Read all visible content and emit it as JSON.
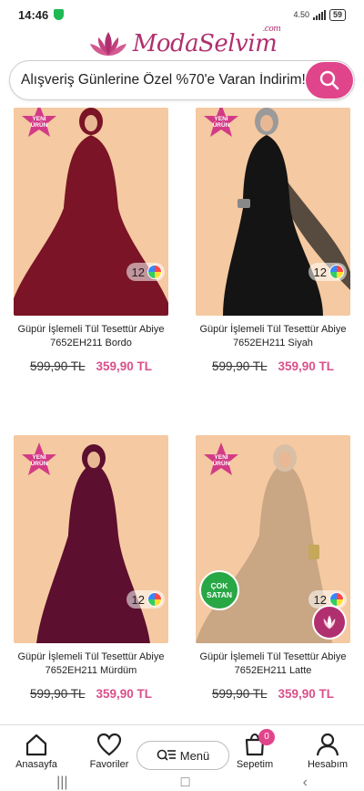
{
  "status_bar": {
    "time": "14:46",
    "network": "4.50",
    "battery": "59"
  },
  "header": {
    "logo_text": "ModaSelvim",
    "logo_suffix": ".com"
  },
  "search": {
    "text": "Alışveriş Günlerine Özel %70'e Varan İndirim!"
  },
  "products": [
    {
      "title_line1": "Güpür İşlemeli Tül Tesettür Abiye",
      "title_line2": "7652EH211 Bordo",
      "old_price": "599,90 TL",
      "new_price": "359,90 TL",
      "color_count": "12",
      "new_badge": [
        "YENİ",
        "ÜRÜN"
      ],
      "dress_color": "#7a1426",
      "hijab_color": "#7a1426"
    },
    {
      "title_line1": "Güpür İşlemeli Tül Tesettür Abiye",
      "title_line2": "7652EH211 Siyah",
      "old_price": "599,90 TL",
      "new_price": "359,90 TL",
      "color_count": "12",
      "new_badge": [
        "YENİ",
        "ÜRÜN"
      ],
      "dress_color": "#141414",
      "hijab_color": "#9a9a9a"
    },
    {
      "title_line1": "Güpür İşlemeli Tül Tesettür Abiye",
      "title_line2": "7652EH211 Mürdüm",
      "old_price": "599,90 TL",
      "new_price": "359,90 TL",
      "color_count": "12",
      "new_badge": [
        "YENİ",
        "ÜRÜN"
      ],
      "dress_color": "#5c0f2e",
      "hijab_color": "#5c0f2e"
    },
    {
      "title_line1": "Güpür İşlemeli Tül Tesettür Abiye",
      "title_line2": "7652EH211 Latte",
      "old_price": "599,90 TL",
      "new_price": "359,90 TL",
      "color_count": "12",
      "new_badge": [
        "YENİ",
        "ÜRÜN"
      ],
      "bestseller": "ÇOK SATAN",
      "dress_color": "#c9a684",
      "hijab_color": "#d8bfa6"
    }
  ],
  "nav": {
    "home": "Anasayfa",
    "favorites": "Favoriler",
    "menu": "Menü",
    "cart": "Sepetim",
    "cart_count": "0",
    "account": "Hesabım"
  },
  "colors": {
    "brand": "#b0306f",
    "accent": "#e0458b",
    "price": "#d94f8a",
    "badge_green": "#28a745",
    "card_bg": "#f5c9a1"
  }
}
